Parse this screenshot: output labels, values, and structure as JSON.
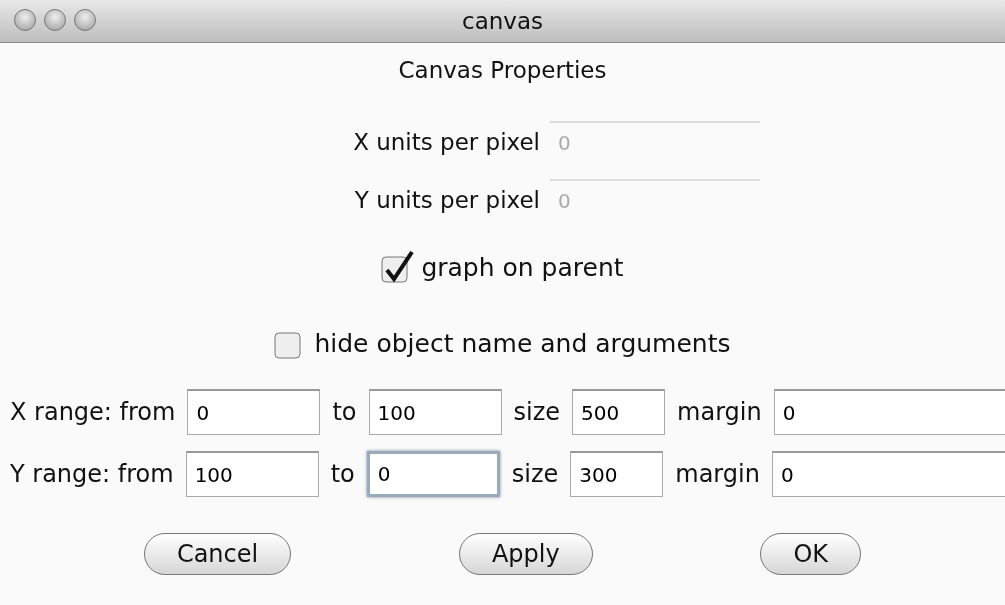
{
  "window": {
    "title": "canvas"
  },
  "heading": "Canvas Properties",
  "units": [
    {
      "label": "X units per pixel",
      "value": "0",
      "disabled": true
    },
    {
      "label": "Y units per pixel",
      "value": "0",
      "disabled": true
    }
  ],
  "checkboxes": [
    {
      "label": "graph on parent",
      "checked": true
    },
    {
      "label": "hide object name and arguments",
      "checked": false
    }
  ],
  "ranges": [
    {
      "fields": [
        {
          "label": "X range: from",
          "value": "0",
          "focused": false
        },
        {
          "label": "to",
          "value": "100",
          "focused": false
        },
        {
          "label": "size",
          "value": "500",
          "focused": false
        },
        {
          "label": "margin",
          "value": "0",
          "focused": false
        }
      ]
    },
    {
      "fields": [
        {
          "label": "Y range: from",
          "value": "100",
          "focused": false
        },
        {
          "label": "to",
          "value": "0",
          "focused": true
        },
        {
          "label": "size",
          "value": "300",
          "focused": false
        },
        {
          "label": "margin",
          "value": "0",
          "focused": false
        }
      ]
    }
  ],
  "buttons": [
    "Cancel",
    "Apply",
    "OK"
  ]
}
